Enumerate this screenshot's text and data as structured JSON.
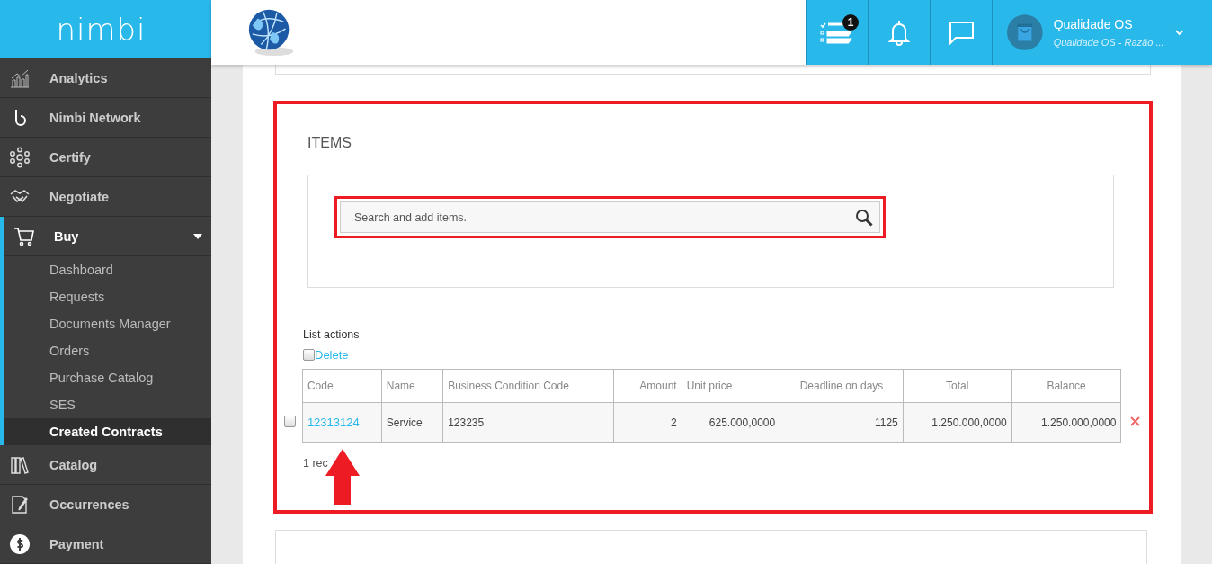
{
  "brand": {
    "logo_text": "nimbi"
  },
  "topbar": {
    "tasks_badge": "1",
    "user": {
      "name": "Qualidade OS",
      "company": "Qualidade OS - Razão ..."
    }
  },
  "sidebar": {
    "items": [
      {
        "label": "Analytics",
        "selected": false
      },
      {
        "label": "Nimbi Network",
        "selected": false
      },
      {
        "label": "Certify",
        "selected": false
      },
      {
        "label": "Negotiate",
        "selected": false
      },
      {
        "label": "Buy",
        "selected": true,
        "expanded": true,
        "children": [
          {
            "label": "Dashboard",
            "selected": false
          },
          {
            "label": "Requests",
            "selected": false
          },
          {
            "label": "Documents Manager",
            "selected": false
          },
          {
            "label": "Orders",
            "selected": false
          },
          {
            "label": "Purchase Catalog",
            "selected": false
          },
          {
            "label": "SES",
            "selected": false
          },
          {
            "label": "Created Contracts",
            "selected": true
          }
        ]
      },
      {
        "label": "Catalog",
        "selected": false
      },
      {
        "label": "Occurrences",
        "selected": false
      },
      {
        "label": "Payment",
        "selected": false
      }
    ]
  },
  "items_section": {
    "title": "ITEMS",
    "search": {
      "placeholder": "Search and add items."
    },
    "list_actions": {
      "label": "List actions",
      "delete": {
        "label": "Delete",
        "checked": false
      }
    },
    "table": {
      "columns": [
        "Code",
        "Name",
        "Business Condition Code",
        "Amount",
        "Unit price",
        "Deadline on days",
        "Total",
        "Balance"
      ],
      "rows": [
        {
          "selected": false,
          "cells": [
            "12313124",
            "Service",
            "123235",
            "2",
            "625.000,0000",
            "1125",
            "1.250.000,0000",
            "1.250.000,0000"
          ]
        }
      ]
    },
    "record_count": "1 rec"
  }
}
